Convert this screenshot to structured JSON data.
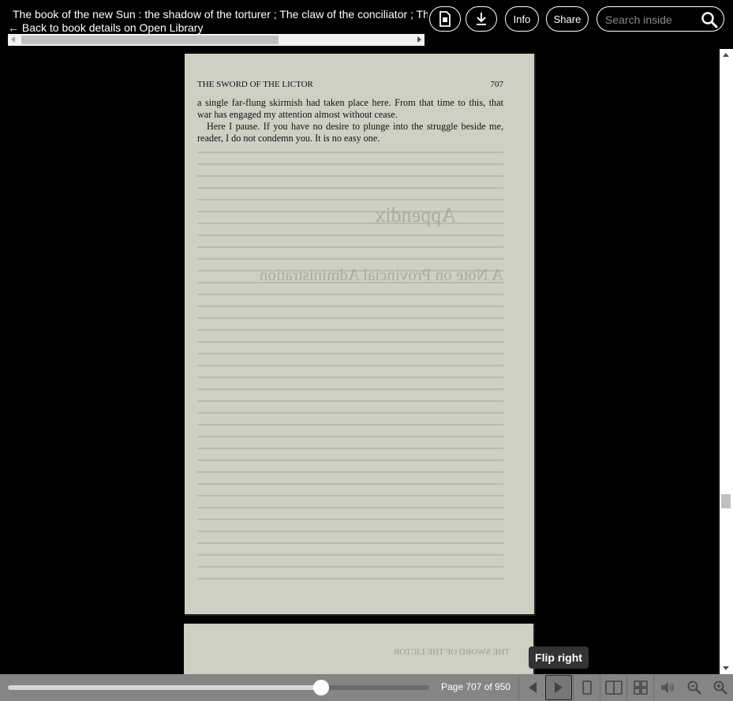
{
  "header": {
    "book_title": "The book of the new Sun : the shadow of the torturer ; The claw of the conciliator ; The sword of the lictor ; The citadel of the autarch",
    "back_link": "← Back to book details on Open Library",
    "info_label": "Info",
    "share_label": "Share",
    "search_placeholder": "Search inside"
  },
  "page": {
    "running_head": "THE SWORD OF THE LICTOR",
    "page_number": "707",
    "paragraphs": [
      "a single far-flung skirmish had taken place here. From that time to this, that war has engaged my attention almost without cease.",
      "Here I pause. If you have no desire to plunge into the struggle beside me, reader, I do not condemn you. It is no easy one."
    ],
    "bleed_through": [
      "Appendix",
      "A Note on Provincial Administration"
    ],
    "next_page_ghost": "THE SWORD OF THE LICTOR"
  },
  "tooltip": "Flip right",
  "footer": {
    "page_indicator": "Page 707 of 950",
    "current_page": 707,
    "total_pages": 950
  },
  "icons": {
    "pdf": "pdf-file-icon",
    "download": "download-icon",
    "search": "search-icon",
    "flip_left": "flip-left-icon",
    "flip_right": "flip-right-icon",
    "one_page": "one-page-view-icon",
    "two_page": "two-page-view-icon",
    "thumbnails": "thumbnail-view-icon",
    "read_aloud": "read-aloud-icon",
    "zoom_out": "zoom-out-icon",
    "zoom_in": "zoom-in-icon"
  }
}
